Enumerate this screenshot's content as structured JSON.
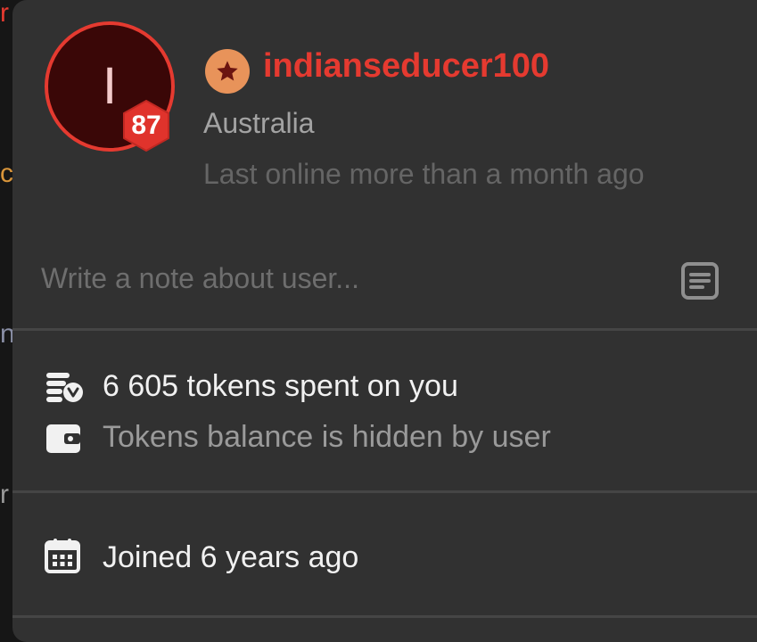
{
  "background_fragments": [
    {
      "text": "r",
      "color": "#e53a30"
    },
    {
      "text": "c",
      "color": "#d9953a"
    },
    {
      "text": "n",
      "color": "#8a8fa6"
    },
    {
      "text": "r",
      "color": "#9a9a9a"
    }
  ],
  "profile": {
    "avatar_initial": "I",
    "level": "87",
    "username": "indianseducer100",
    "location": "Australia",
    "last_online": "Last online more than a month ago"
  },
  "note": {
    "placeholder": "Write a note about user...",
    "value": ""
  },
  "tokens": {
    "spent_text": "6 605 tokens spent on you",
    "balance_text": "Tokens balance is hidden by user"
  },
  "joined": {
    "text": "Joined 6 years ago"
  },
  "colors": {
    "accent": "#e53a30",
    "card_bg": "#313131",
    "star_badge": "#e8935a"
  },
  "icons": {
    "star_badge": "star-icon",
    "note": "document-icon",
    "tokens_spent": "coins-stack-icon",
    "balance": "wallet-icon",
    "joined": "calendar-icon"
  }
}
